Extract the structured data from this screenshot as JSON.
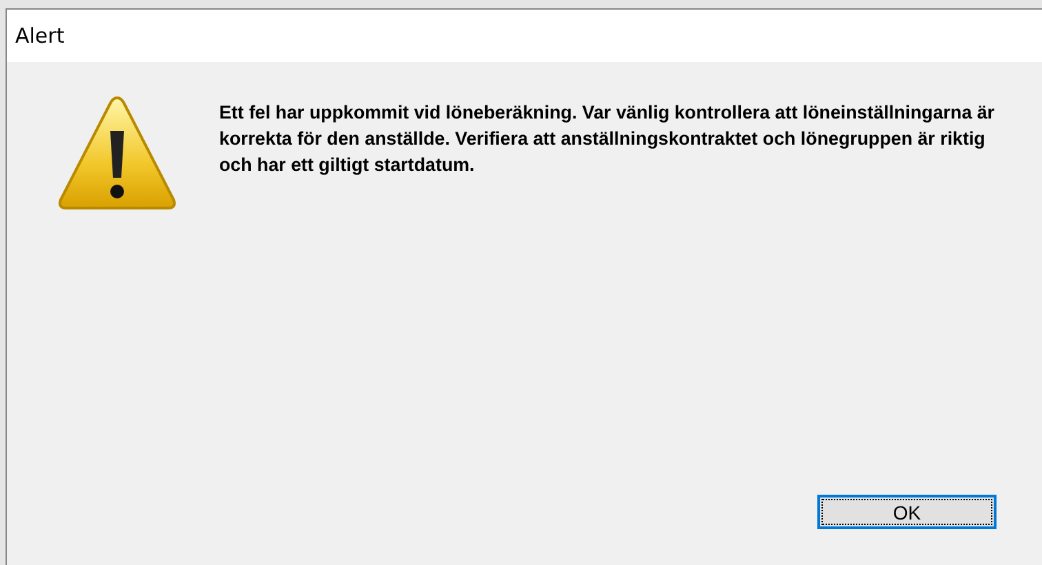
{
  "window": {
    "title": "Alert"
  },
  "message": "Ett fel har uppkommit vid löneberäkning. Var vänlig kontrollera att löneinställningarna är korrekta för den anställde. Verifiera att anställningskontraktet och lönegruppen är riktig och har ett giltigt startdatum.",
  "buttons": [
    {
      "label": "OK",
      "selected": true
    }
  ]
}
